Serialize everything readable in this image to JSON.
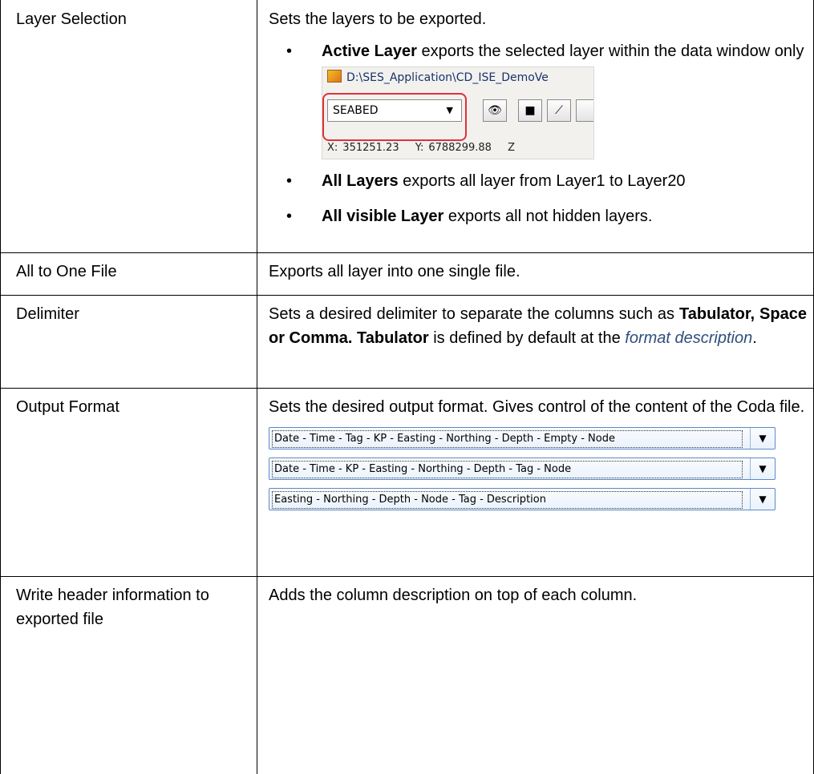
{
  "rows": [
    {
      "label": "Layer Selection",
      "description": "Sets the layers to be exported.",
      "bullets": [
        {
          "bold": "Active Layer",
          "text": " exports the selected layer within the data window only"
        },
        {
          "bold": "All Layers",
          "text": " exports all layer from Layer1 to Layer20"
        },
        {
          "bold": "All visible Layer",
          "text": " exports all not hidden layers."
        }
      ],
      "screenshot": {
        "path": "D:\\SES_Application\\CD_ISE_DemoVe",
        "layer_value": "SEABED",
        "x_label": "X:",
        "x_value": "351251.23",
        "y_label": "Y:",
        "y_value": "6788299.88",
        "z_label": "Z",
        "highlight_color": "#e0303a"
      }
    },
    {
      "label": "All to One File",
      "description": "Exports all layer into one single file."
    },
    {
      "label": "Delimiter",
      "description_parts": {
        "t1": "Sets a desired delimiter to separate the columns such as ",
        "b1": "Tabulator, Space or Comma. Tabulator",
        "t2": " is defined by default at the ",
        "link": "format description",
        "t3": "."
      }
    },
    {
      "label": "Output Format",
      "description": "Sets the desired output format. Gives control of the content of the Coda file.",
      "formats": [
        "Date - Time - Tag - KP - Easting - Northing - Depth - Empty - Node",
        "Date - Time - KP - Easting - Northing - Depth - Tag - Node",
        "Easting - Northing - Depth - Node - Tag - Description"
      ]
    },
    {
      "label": "Write header information to exported file",
      "description": "Adds the column description on top of each column."
    }
  ],
  "colors": {
    "link": "#2e4f7a",
    "combo_border": "#5b8bc8"
  }
}
